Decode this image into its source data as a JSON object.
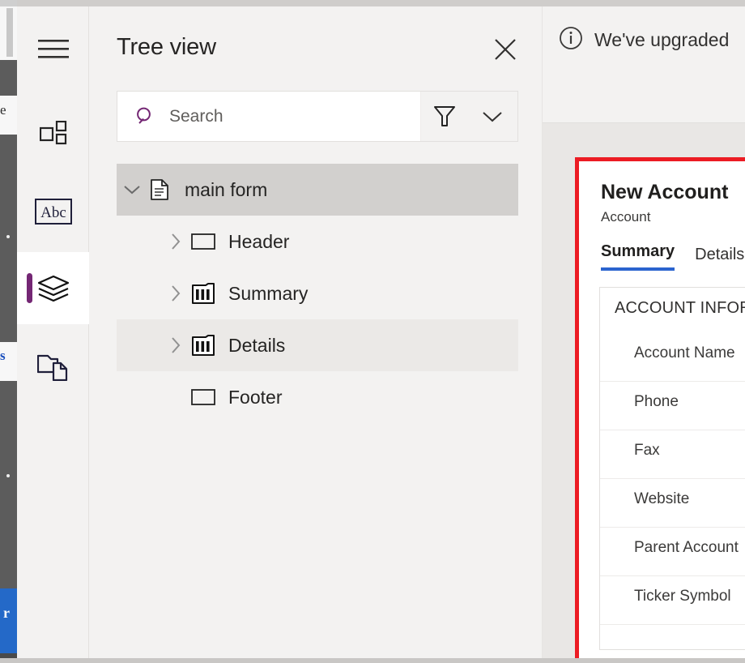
{
  "window": {
    "background_color": "#f3f2f1",
    "canvas_color": "#e9e7e5"
  },
  "icon_rail": {
    "items": [
      {
        "name": "menu",
        "icon": "hamburger-menu-icon",
        "selected": false
      },
      {
        "name": "components",
        "icon": "components-grid-icon",
        "selected": false
      },
      {
        "name": "text",
        "icon": "abc-text-icon",
        "selected": false
      },
      {
        "name": "tree-view",
        "icon": "layers-stack-icon",
        "selected": true
      },
      {
        "name": "pages",
        "icon": "folder-file-icon",
        "selected": false
      }
    ],
    "selection_accent_color": "#742774"
  },
  "tree_panel": {
    "title": "Tree view",
    "close_label": "Close",
    "search": {
      "placeholder": "Search",
      "value": "",
      "search_icon": "magnifier-icon",
      "filter_icon": "funnel-filter-icon",
      "chevron_icon": "chevron-down-icon"
    },
    "items": [
      {
        "label": "main form",
        "icon": "document-icon",
        "caret": "chevron-down",
        "indent": 0,
        "state": "selected"
      },
      {
        "label": "Header",
        "icon": "rectangle-icon",
        "caret": "chevron-right",
        "indent": 1,
        "state": "normal"
      },
      {
        "label": "Summary",
        "icon": "columns-icon",
        "caret": "chevron-right",
        "indent": 1,
        "state": "normal"
      },
      {
        "label": "Details",
        "icon": "columns-icon",
        "caret": "chevron-right",
        "indent": 1,
        "state": "hover"
      },
      {
        "label": "Footer",
        "icon": "rectangle-icon",
        "caret": "none",
        "indent": 1,
        "state": "normal"
      }
    ]
  },
  "canvas": {
    "notification": {
      "icon": "info-circle-icon",
      "text": "We've upgraded"
    },
    "form_preview": {
      "highlight_color": "#ec1c24",
      "title": "New Account",
      "subtitle": "Account",
      "tabs": [
        {
          "label": "Summary",
          "active": true
        },
        {
          "label": "Details",
          "active": false
        }
      ],
      "tab_accent_color": "#2b64cf",
      "section_label": "ACCOUNT INFOR",
      "fields": [
        "Account Name",
        "Phone",
        "Fax",
        "Website",
        "Parent Account",
        "Ticker Symbol"
      ]
    }
  },
  "edge_strip": {
    "fragment_texts": [
      "e",
      "s",
      "r"
    ]
  }
}
